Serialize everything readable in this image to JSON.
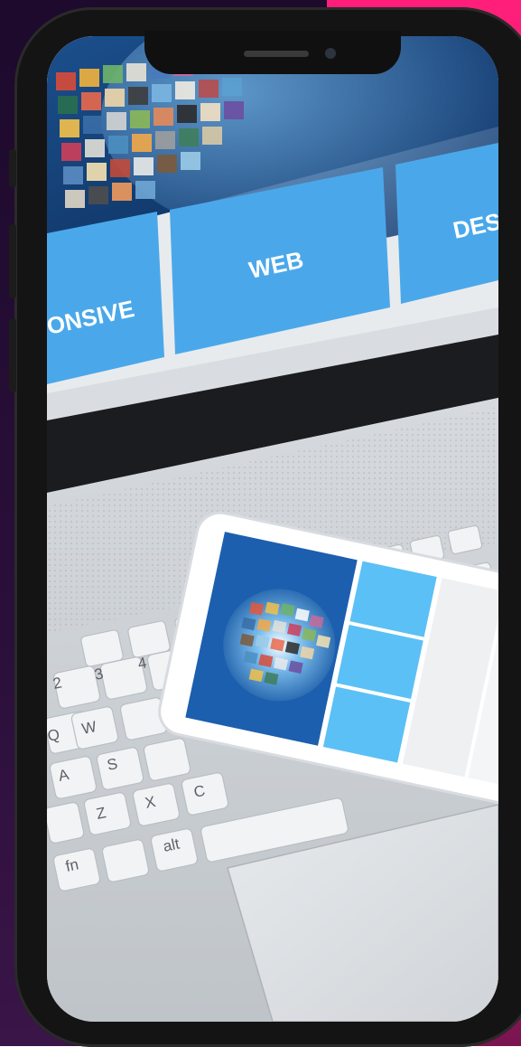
{
  "photo": {
    "subject": "smartphone-mockup-responsive-web-design",
    "panels": [
      "ONSIVE",
      "WEB",
      "DES"
    ],
    "keys": [
      "2",
      "3",
      "4",
      "W",
      "Q",
      "A",
      "S",
      "Z",
      "X",
      "C",
      "fn",
      "alt"
    ]
  },
  "colors": {
    "background_dark": "#1d0a2c",
    "background_pink": "#ff1f7a",
    "phone_frame": "#141414",
    "panel_blue": "#4aa8ea",
    "laptop_silver": "#c9cdd2"
  }
}
